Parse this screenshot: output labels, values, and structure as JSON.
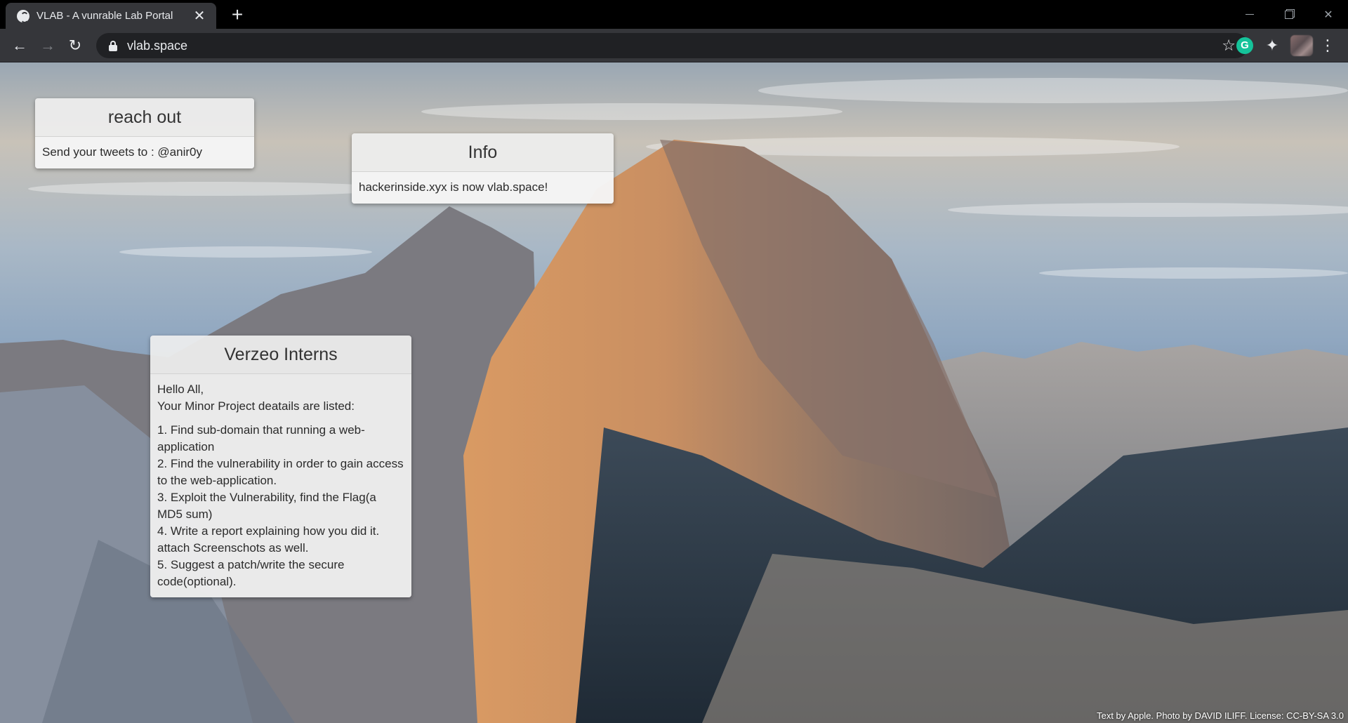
{
  "browser": {
    "tab_title": "VLAB - A vunrable Lab Portal",
    "url": "vlab.space"
  },
  "cards": {
    "reach_out": {
      "title": "reach out",
      "body": "Send your tweets to : @anir0y"
    },
    "info": {
      "title": "Info",
      "body": "hackerinside.xyx is now vlab.space!"
    },
    "interns": {
      "title": "Verzeo Interns",
      "greeting": "Hello All,",
      "intro": "Your Minor Project deatails are listed:",
      "tasks": [
        "1. Find sub-domain that running a web-application",
        "2. Find the vulnerability in order to gain access to the web-application.",
        "3. Exploit the Vulnerability, find the Flag(a MD5 sum)",
        "4. Write a report explaining how you did it. attach Screenschots as well.",
        "5. Suggest a patch/write the secure code(optional)."
      ]
    }
  },
  "footer": {
    "credit": "Text by Apple. Photo by DAVID ILIFF. License: CC-BY-SA 3.0"
  },
  "colors": {
    "tabstrip": "#000000",
    "toolbar": "#35363a",
    "omnibox": "#202124",
    "card_bg": "#eeeeee"
  },
  "icons": [
    "globe-icon",
    "close-icon",
    "plus-icon",
    "back-icon",
    "forward-icon",
    "reload-icon",
    "lock-icon",
    "star-icon",
    "grammarly-icon",
    "puzzle-icon",
    "kebab-menu-icon"
  ]
}
